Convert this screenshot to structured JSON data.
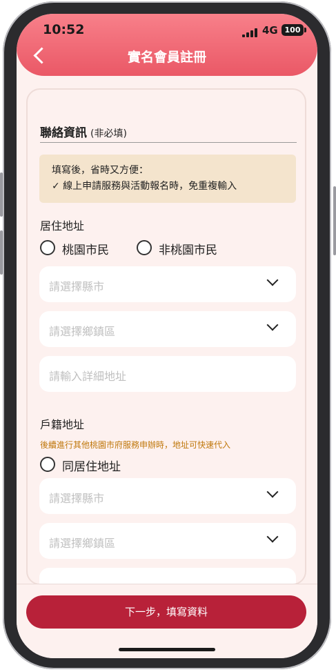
{
  "status": {
    "time": "10:52",
    "network": "4G",
    "battery": "100"
  },
  "header": {
    "title": "實名會員註冊"
  },
  "contact": {
    "title": "聯絡資訊",
    "optional": "(非必填)",
    "info_line1": "填寫後，省時又方便：",
    "info_line2": "✓ 線上申請服務與活動報名時，免重複輸入"
  },
  "residence": {
    "label": "居住地址",
    "options": [
      "桃園市民",
      "非桃園市民"
    ],
    "county_placeholder": "請選擇縣市",
    "district_placeholder": "請選擇鄉鎮區",
    "detail_placeholder": "請輸入詳細地址"
  },
  "household": {
    "label": "戶籍地址",
    "hint": "後續進行其他桃園市府服務申辦時，地址可快速代入",
    "same_label": "同居住地址",
    "county_placeholder": "請選擇縣市",
    "district_placeholder": "請選擇鄉鎮區"
  },
  "footer": {
    "next_label": "下一步，填寫資料"
  }
}
